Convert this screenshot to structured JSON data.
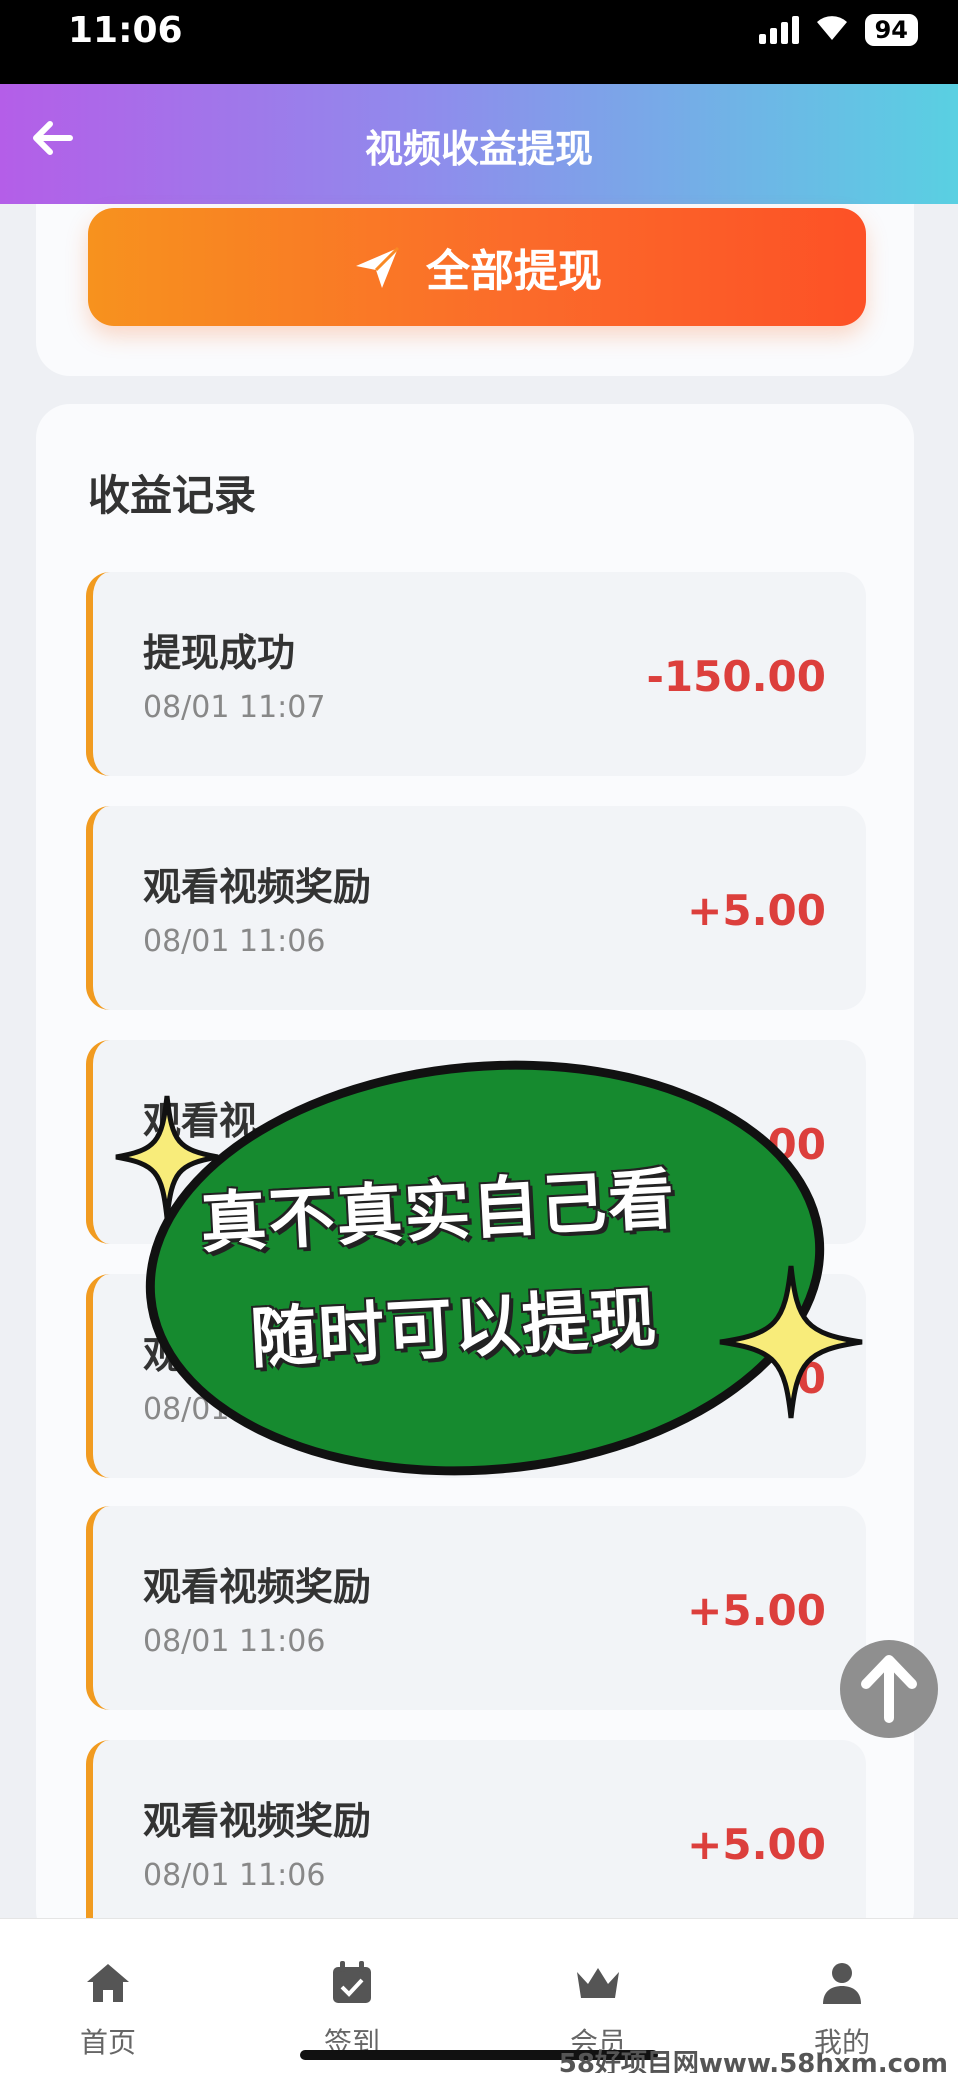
{
  "status_bar": {
    "time": "11:06",
    "battery": "94"
  },
  "header": {
    "title": "视频收益提现",
    "back_icon": "arrow-left-icon"
  },
  "withdraw_button": {
    "label": "全部提现",
    "icon": "paper-plane-icon",
    "colors": [
      "#f7921e",
      "#fd5126"
    ]
  },
  "records": {
    "title": "收益记录",
    "items": [
      {
        "label": "提现成功",
        "time": "08/01 11:07",
        "amount": "-150.00"
      },
      {
        "label": "观看视频奖励",
        "time": "08/01 11:06",
        "amount": "+5.00"
      },
      {
        "label": "观看视",
        "time": "",
        "amount": ".00"
      },
      {
        "label": "观",
        "time": "08/01",
        "amount": "0"
      },
      {
        "label": "观看视频奖励",
        "time": "08/01 11:06",
        "amount": "+5.00"
      },
      {
        "label": "观看视频奖励",
        "time": "08/01 11:06",
        "amount": "+5.00"
      }
    ]
  },
  "overlay": {
    "line1": "真不真实自己看",
    "line2": "随时可以提现"
  },
  "scroll_top": {
    "icon": "arrow-up-icon",
    "label": "↑"
  },
  "tabbar": {
    "items": [
      {
        "label": "首页",
        "icon": "home-icon"
      },
      {
        "label": "签到",
        "icon": "calendar-check-icon"
      },
      {
        "label": "会员",
        "icon": "crown-icon"
      },
      {
        "label": "我的",
        "icon": "user-icon"
      }
    ]
  },
  "watermark": "58好项目网www.58hxm.com",
  "colors": {
    "accent_red": "#dc3f3c",
    "accent_orange": "#f19b20",
    "overlay_green": "#168a2f"
  }
}
